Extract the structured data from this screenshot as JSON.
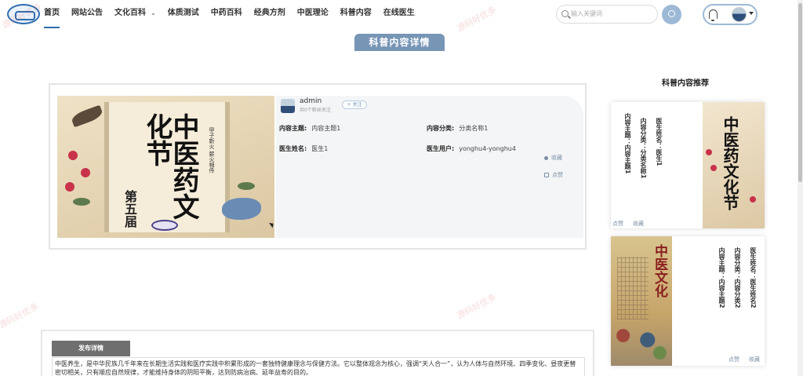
{
  "nav": {
    "items": [
      {
        "label": "首页",
        "active": true
      },
      {
        "label": "网站公告"
      },
      {
        "label": "文化百科",
        "dropdown": true
      },
      {
        "label": "体质测试"
      },
      {
        "label": "中药百科"
      },
      {
        "label": "经典方剂"
      },
      {
        "label": "中医理论"
      },
      {
        "label": "科普内容"
      },
      {
        "label": "在线医生"
      }
    ]
  },
  "search": {
    "placeholder": "输入关键词"
  },
  "page_title": "科普内容详情",
  "poster": {
    "title": "中医药文化节",
    "subtitle": "第五届",
    "side_text": "甲子新火 薪火相传"
  },
  "author": {
    "name": "admin",
    "followers": "共0个粉丝关注",
    "follow_label": "+ 关注"
  },
  "fields": {
    "topic_label": "内容主题:",
    "topic_value": "内容主题1",
    "category_label": "内容分类:",
    "category_value": "分类名称1",
    "doctor_label": "医生姓名:",
    "doctor_value": "医生1",
    "user_label": "医生用户:",
    "user_value": "yonghu4-yonghu4"
  },
  "actions": {
    "favorite": "收藏",
    "like": "点赞"
  },
  "recommend": {
    "title": "科普内容推荐",
    "cards": [
      {
        "lines": [
          "医生姓名：医生1",
          "内容分类：分类名称1",
          "内容主题：内容主题1"
        ],
        "image_title": "中医药文化节",
        "like": "点赞",
        "favorite": "收藏"
      },
      {
        "lines": [
          "医生姓名：医生姓名2",
          "内容分类：内容分类2",
          "内容主题：内容主题2"
        ],
        "image_title": "中医文化",
        "like": "点赞",
        "favorite": "收藏"
      }
    ]
  },
  "detail": {
    "tab_label": "发布详情",
    "text": "中医养生，是中华民族几千年来在长期生活实践和医疗实践中积累形成的一套独特健康理念与保健方法。它以整体观念为核心，强调“天人合一”，认为人体与自然环境、四季变化、昼夜更替密切相关，只有顺应自然规律，才能维持身体的阴阳平衡，达到防病治病、延年益寿的目的。"
  },
  "watermark": "源码好优多"
}
